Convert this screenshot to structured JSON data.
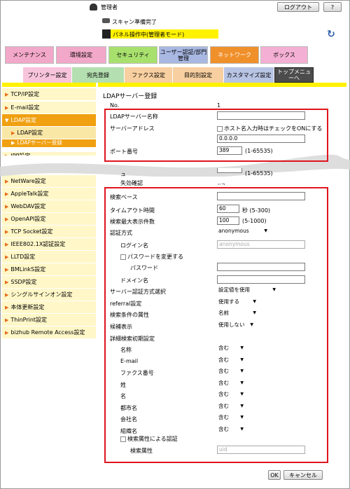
{
  "header": {
    "admin_label": "管理者",
    "logout_label": "ログアウト",
    "scan_status": "スキャン準備完了",
    "panel_status": "パネル操作中(管理者モード)",
    "refresh_icon": "refresh-icon"
  },
  "main_tabs": [
    {
      "label": "メンテナンス",
      "color": "#f2a8c8"
    },
    {
      "label": "環境設定",
      "color": "#f2a8c8"
    },
    {
      "label": "セキュリティ",
      "color": "#a8e06e"
    },
    {
      "label": "ユーザー認証/部門管理",
      "color": "#a9b8e2"
    },
    {
      "label": "ネットワーク",
      "color": "#f0902a"
    },
    {
      "label": "ボックス",
      "color": "#f4b0d4"
    }
  ],
  "sub_tabs": [
    {
      "label": "プリンター設定",
      "color": "#f7c4dc"
    },
    {
      "label": "宛先登録",
      "color": "#b4dfb0"
    },
    {
      "label": "ファクス設定",
      "color": "#f7cfa0"
    },
    {
      "label": "目的別設定",
      "color": "#f7cfa0"
    },
    {
      "label": "カスタマイズ設定",
      "color": "#b8c4e4"
    },
    {
      "label": "トップメニューへ",
      "color": "#4c4c4c"
    }
  ],
  "sidebar": [
    {
      "label": "TCP/IP設定",
      "kind": "normal"
    },
    {
      "label": "E-mail設定",
      "kind": "normal"
    },
    {
      "label": "LDAP設定",
      "kind": "open"
    },
    {
      "label": "LDAP設定",
      "kind": "sub"
    },
    {
      "label": "LDAPサーバー登録",
      "kind": "selected"
    },
    {
      "label": "IPP設定",
      "kind": "normal"
    },
    {
      "label": "NetWare設定",
      "kind": "normal"
    },
    {
      "label": "AppleTalk設定",
      "kind": "normal"
    },
    {
      "label": "WebDAV設定",
      "kind": "normal"
    },
    {
      "label": "OpenAPI設定",
      "kind": "normal"
    },
    {
      "label": "TCP Socket設定",
      "kind": "normal"
    },
    {
      "label": "IEEE802.1X認証設定",
      "kind": "normal"
    },
    {
      "label": "LLTD設定",
      "kind": "normal"
    },
    {
      "label": "BMLinkS設定",
      "kind": "normal"
    },
    {
      "label": "SSDP設定",
      "kind": "normal"
    },
    {
      "label": "シングルサインオン設定",
      "kind": "normal"
    },
    {
      "label": "本体更新設定",
      "kind": "normal"
    },
    {
      "label": "ThinPrint設定",
      "kind": "normal"
    },
    {
      "label": "bizhub Remote Access設定",
      "kind": "normal"
    }
  ],
  "form": {
    "title": "LDAPサーバー登録",
    "no_label": "No.",
    "no_value": "1",
    "server_name_label": "LDAPサーバー名称",
    "server_name_value": "",
    "server_address_label": "サーバーアドレス",
    "hostname_check_label": "ホスト名入力時はチェックをONにする",
    "server_address_value": "0.0.0.0",
    "port_label": "ポート番号",
    "port_value": "389",
    "port_range": "(1-65535)",
    "partial_label_1": "ュ",
    "partial_range": "(1-65535)",
    "partial_label_2": "失効確認",
    "partial_label_3": "ドフ",
    "search_base_label": "検索ベース",
    "search_base_value": "",
    "timeout_label": "タイムアウト時間",
    "timeout_value": "60",
    "timeout_unit": "秒 (5-300)",
    "max_results_label": "検索最大表示件数",
    "max_results_value": "100",
    "max_results_range": "(5-1000)",
    "auth_method_label": "認証方式",
    "auth_method_value": "anonymous",
    "login_name_label": "ログイン名",
    "login_name_placeholder": "anonymous",
    "change_password_label": "パスワードを変更する",
    "password_label": "パスワード",
    "password_value": "",
    "domain_label": "ドメイン名",
    "domain_value": "",
    "server_auth_label": "サーバー認証方式選択",
    "server_auth_value": "設定値を使用",
    "referral_label": "referral設定",
    "referral_value": "使用する",
    "search_attr_label": "検索条件の属性",
    "search_attr_value": "名前",
    "candidate_label": "候補表示",
    "candidate_value": "使用しない",
    "detail_label": "詳細検索初期設定",
    "detail_rows": [
      {
        "label": "名称",
        "value": "含む"
      },
      {
        "label": "E-mail",
        "value": "含む"
      },
      {
        "label": "ファクス番号",
        "value": "含む"
      },
      {
        "label": "姓",
        "value": "含む"
      },
      {
        "label": "名",
        "value": "含む"
      },
      {
        "label": "都市名",
        "value": "含む"
      },
      {
        "label": "会社名",
        "value": "含む"
      },
      {
        "label": "組織名",
        "value": "含む"
      }
    ],
    "attr_auth_label": "検索属性による認証",
    "search_attribute_label": "検索属性",
    "search_attribute_placeholder": "uid"
  },
  "footer": {
    "ok_label": "OK",
    "cancel_label": "キャンセル"
  },
  "colors": {
    "highlight_red": "#e0141e",
    "sidebar_bg": "#fff7c8",
    "sidebar_active": "#f0a010",
    "panel_yellow": "#fff200"
  }
}
